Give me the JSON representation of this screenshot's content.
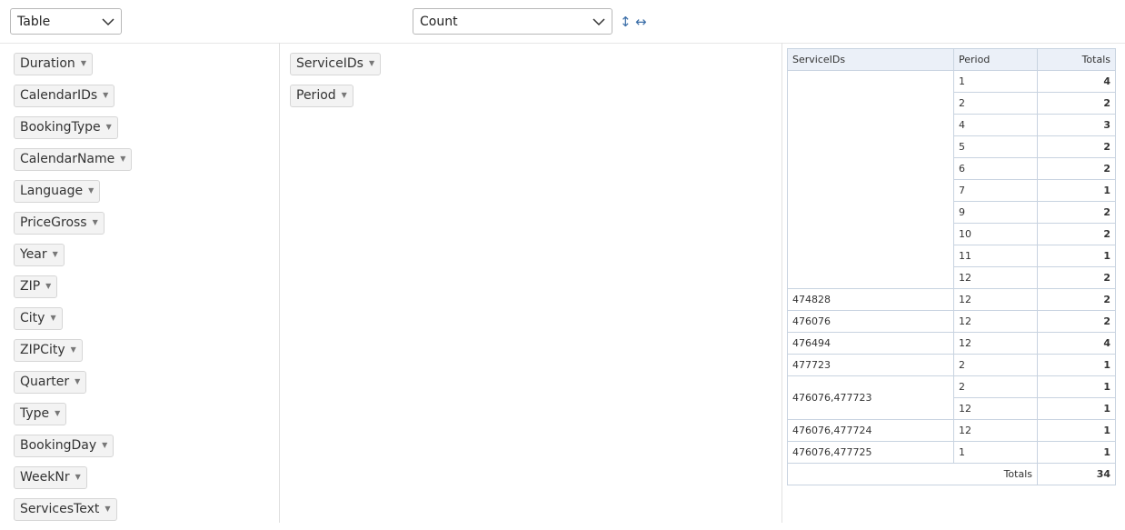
{
  "toolbar": {
    "renderer": "Table",
    "aggregator": "Count",
    "row_order_icon": "↕",
    "col_order_icon": "↔"
  },
  "unused_attributes": [
    "Duration",
    "CalendarIDs",
    "BookingType",
    "CalendarName",
    "Language",
    "PriceGross",
    "Year",
    "ZIP",
    "City",
    "ZIPCity",
    "Quarter",
    "Type",
    "BookingDay",
    "WeekNr",
    "ServicesText"
  ],
  "row_attributes": [
    "ServiceIDs",
    "Period"
  ],
  "pivot_table": {
    "headers": [
      "ServiceIDs",
      "Period",
      "Totals"
    ],
    "groups": [
      {
        "service": "",
        "rows": [
          {
            "period": "1",
            "total": "4"
          },
          {
            "period": "2",
            "total": "2"
          },
          {
            "period": "4",
            "total": "3"
          },
          {
            "period": "5",
            "total": "2"
          },
          {
            "period": "6",
            "total": "2"
          },
          {
            "period": "7",
            "total": "1"
          },
          {
            "period": "9",
            "total": "2"
          },
          {
            "period": "10",
            "total": "2"
          },
          {
            "period": "11",
            "total": "1"
          },
          {
            "period": "12",
            "total": "2"
          }
        ]
      },
      {
        "service": "474828",
        "rows": [
          {
            "period": "12",
            "total": "2"
          }
        ]
      },
      {
        "service": "476076",
        "rows": [
          {
            "period": "12",
            "total": "2"
          }
        ]
      },
      {
        "service": "476494",
        "rows": [
          {
            "period": "12",
            "total": "4"
          }
        ]
      },
      {
        "service": "477723",
        "rows": [
          {
            "period": "2",
            "total": "1"
          }
        ]
      },
      {
        "service": "476076,477723",
        "rows": [
          {
            "period": "2",
            "total": "1"
          },
          {
            "period": "12",
            "total": "1"
          }
        ]
      },
      {
        "service": "476076,477724",
        "rows": [
          {
            "period": "12",
            "total": "1"
          }
        ]
      },
      {
        "service": "476076,477725",
        "rows": [
          {
            "period": "1",
            "total": "1"
          }
        ]
      }
    ],
    "grand_total_label": "Totals",
    "grand_total": "34"
  }
}
